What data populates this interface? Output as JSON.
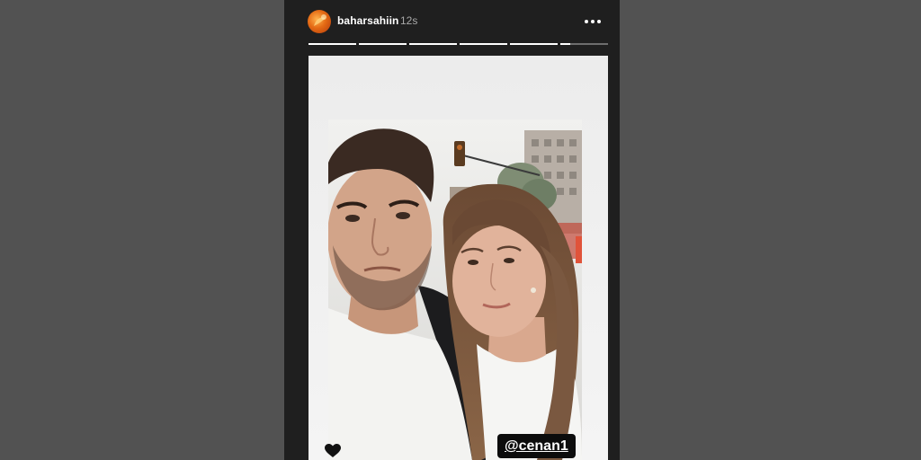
{
  "story": {
    "username": "baharsahiin",
    "timestamp": "12s",
    "segments": [
      {
        "progress": 1.0
      },
      {
        "progress": 1.0
      },
      {
        "progress": 1.0
      },
      {
        "progress": 1.0
      },
      {
        "progress": 1.0
      },
      {
        "progress": 0.2
      }
    ],
    "mention": "@cenan1",
    "icons": {
      "avatar": "avatar",
      "more": "more-options-icon",
      "heart": "heart-icon"
    }
  },
  "colors": {
    "page_background": "#525252",
    "story_background": "#1f1f1f",
    "progress_active": "#ffffff",
    "progress_inactive": "rgba(255,255,255,0.35)"
  }
}
